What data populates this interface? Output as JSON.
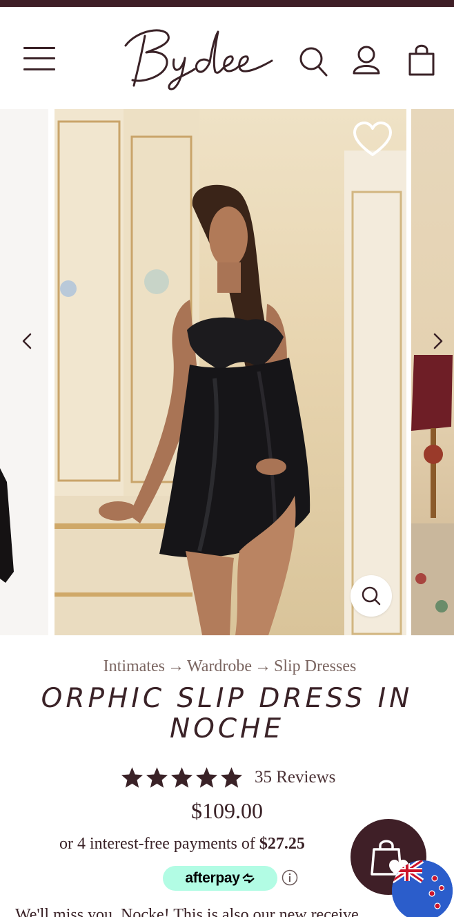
{
  "brand": {
    "name": "Bydee",
    "color": "#3f1f27"
  },
  "header": {
    "menu_icon": "hamburger-icon",
    "search_icon": "search-icon",
    "account_icon": "user-icon",
    "cart_icon": "shopping-bag-icon"
  },
  "gallery": {
    "prev_icon": "chevron-left-icon",
    "next_icon": "chevron-right-icon",
    "wishlist_icon": "heart-icon",
    "zoom_icon": "search-icon"
  },
  "breadcrumb": {
    "items": [
      "Intimates",
      "Wardrobe",
      "Slip Dresses"
    ],
    "separator": "→"
  },
  "product": {
    "title": "ORPHIC SLIP DRESS IN NOCHE",
    "rating": 5,
    "reviews_label": "35 Reviews",
    "price": "$109.00"
  },
  "installments": {
    "prefix": "or 4 interest-free payments of",
    "amount": "$27.25"
  },
  "afterpay": {
    "label": "afterpay",
    "bg_color": "#b2fce4"
  },
  "footer": {
    "partial_text": "We'll miss you. Nocke! This is also our new receive..."
  },
  "floating": {
    "cart_icon": "shopping-bag-heart-icon",
    "flag_icon": "new-zealand-flag-icon"
  }
}
